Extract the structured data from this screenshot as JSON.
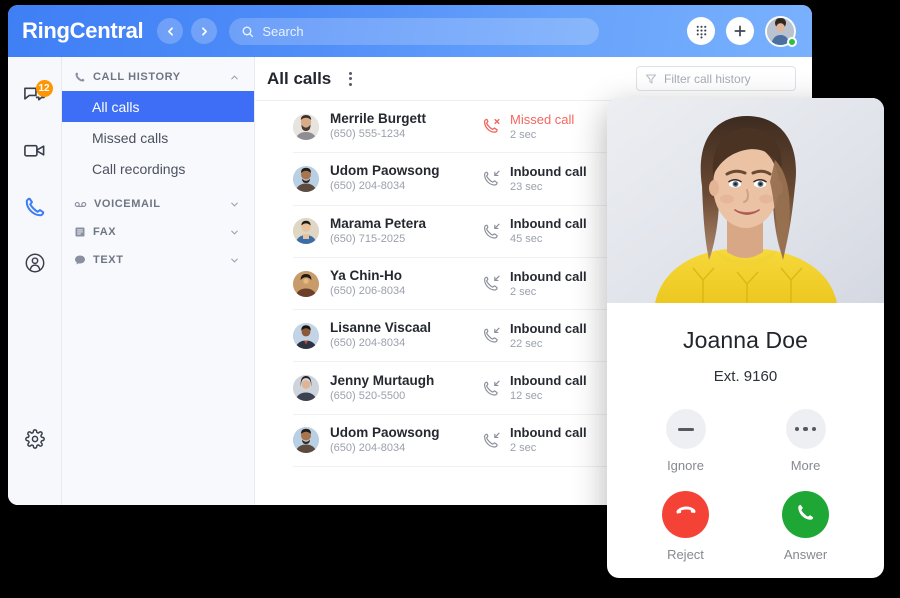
{
  "app": {
    "brand": "RingCentral",
    "nav_back_icon": "chevron-left-icon",
    "nav_forward_icon": "chevron-right-icon",
    "search_placeholder": "Search",
    "search_icon": "search-icon",
    "dialpad_icon": "dialpad-icon",
    "add_icon": "plus-icon",
    "avatar_icon": "user-avatar",
    "status": "online",
    "status_color": "#2fbf3f",
    "header_gradient_from": "#3f7ff5",
    "header_gradient_to": "#79b1fd"
  },
  "rail": {
    "items": [
      {
        "name": "messages",
        "icon": "message-bubbles-icon",
        "badge": "12",
        "active": false
      },
      {
        "name": "video",
        "icon": "video-camera-icon",
        "badge": "",
        "active": false
      },
      {
        "name": "phone",
        "icon": "phone-icon",
        "badge": "",
        "active": true
      },
      {
        "name": "contacts",
        "icon": "contacts-person-icon",
        "badge": "",
        "active": false
      }
    ],
    "settings": {
      "name": "settings",
      "icon": "gear-icon"
    },
    "badge_color": "#ff9500",
    "active_color": "#3d7df6"
  },
  "nav": {
    "groups": [
      {
        "label": "CALL HISTORY",
        "icon": "phone-icon",
        "expanded": true,
        "chevron": "chevron-up-icon",
        "items": [
          {
            "label": "All calls",
            "selected": true
          },
          {
            "label": "Missed calls",
            "selected": false
          },
          {
            "label": "Call recordings",
            "selected": false
          }
        ]
      },
      {
        "label": "VOICEMAIL",
        "icon": "voicemail-icon",
        "expanded": false,
        "chevron": "chevron-down-icon",
        "items": []
      },
      {
        "label": "FAX",
        "icon": "fax-icon",
        "expanded": false,
        "chevron": "chevron-down-icon",
        "items": []
      },
      {
        "label": "TEXT",
        "icon": "text-bubble-icon",
        "expanded": false,
        "chevron": "chevron-down-icon",
        "items": []
      }
    ],
    "selected_bg": "#3d6ef5"
  },
  "content": {
    "title": "All calls",
    "overflow_icon": "kebab-menu-icon",
    "filter_icon": "funnel-filter-icon",
    "filter_placeholder": "Filter call history",
    "missed_color": "#f4665f",
    "calls": [
      {
        "name": "Merrile Burgett",
        "phone": "(650) 555-1234",
        "type": "Missed call",
        "duration": "2 sec",
        "direction": "missed",
        "icon": "phone-missed-icon"
      },
      {
        "name": "Udom Paowsong",
        "phone": "(650) 204-8034",
        "type": "Inbound call",
        "duration": "23 sec",
        "direction": "inbound",
        "icon": "phone-inbound-icon"
      },
      {
        "name": "Marama Petera",
        "phone": "(650) 715-2025",
        "type": "Inbound call",
        "duration": "45 sec",
        "direction": "inbound",
        "icon": "phone-inbound-icon"
      },
      {
        "name": "Ya Chin-Ho",
        "phone": "(650) 206-8034",
        "type": "Inbound call",
        "duration": "2 sec",
        "direction": "inbound",
        "icon": "phone-inbound-icon"
      },
      {
        "name": "Lisanne Viscaal",
        "phone": "(650) 204-8034",
        "type": "Inbound call",
        "duration": "22 sec",
        "direction": "inbound",
        "icon": "phone-inbound-icon"
      },
      {
        "name": "Jenny Murtaugh",
        "phone": "(650) 520-5500",
        "type": "Inbound call",
        "duration": "12 sec",
        "direction": "inbound",
        "icon": "phone-inbound-icon"
      },
      {
        "name": "Udom Paowsong",
        "phone": "(650) 204-8034",
        "type": "Inbound call",
        "duration": "2 sec",
        "direction": "inbound",
        "icon": "phone-inbound-icon"
      }
    ]
  },
  "incoming_call": {
    "photo_alt": "caller-photo",
    "caller_name": "Joanna Doe",
    "extension": "Ext. 9160",
    "actions": [
      {
        "label": "Ignore",
        "icon": "minus-icon",
        "style": "grey"
      },
      {
        "label": "More",
        "icon": "ellipsis-icon",
        "style": "grey"
      },
      {
        "label": "Reject",
        "icon": "phone-hangup-icon",
        "style": "red",
        "color": "#f44336"
      },
      {
        "label": "Answer",
        "icon": "phone-answer-icon",
        "style": "green",
        "color": "#1ea734"
      }
    ]
  }
}
